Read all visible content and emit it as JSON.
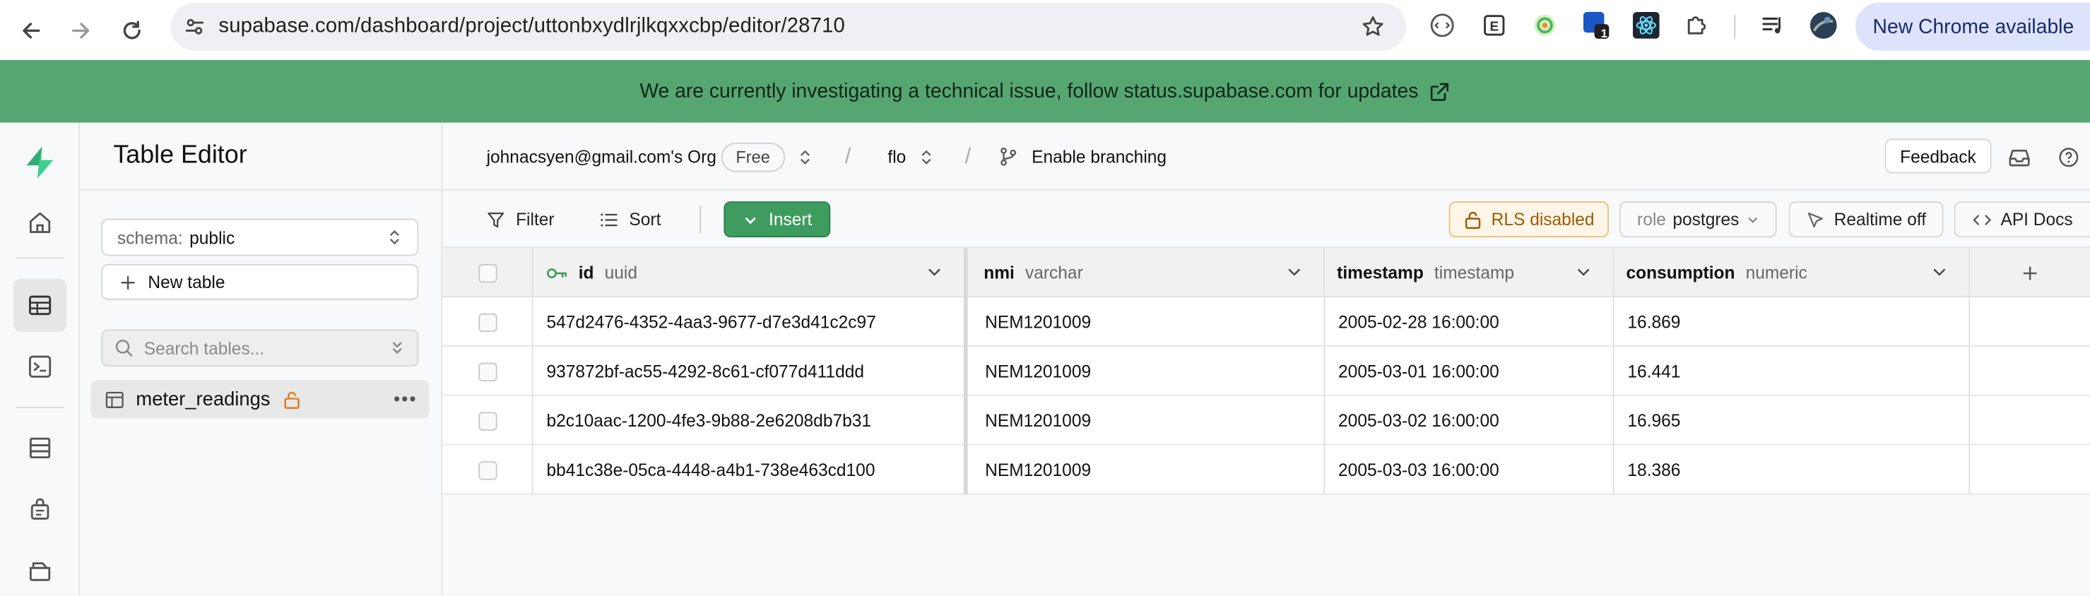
{
  "browser": {
    "url": "supabase.com/dashboard/project/uttonbxydlrjlkqxxcbp/editor/28710",
    "update_label": "New Chrome available",
    "badge_count": "1"
  },
  "banner": {
    "text": "We are currently investigating a technical issue, follow status.supabase.com for updates"
  },
  "sidebar": {
    "title": "Table Editor",
    "schema_label": "schema:",
    "schema_value": "public",
    "new_table_label": "New table",
    "search_placeholder": "Search tables...",
    "tables": [
      {
        "name": "meter_readings"
      }
    ]
  },
  "topbar": {
    "org": "johnacsyen@gmail.com's Org",
    "plan": "Free",
    "project": "flo",
    "branching": "Enable branching",
    "feedback": "Feedback"
  },
  "toolbar": {
    "filter": "Filter",
    "sort": "Sort",
    "insert": "Insert",
    "rls": "RLS disabled",
    "role_label": "role",
    "role_value": "postgres",
    "realtime": "Realtime off",
    "api_docs": "API Docs"
  },
  "grid": {
    "columns": [
      {
        "name": "id",
        "type": "uuid"
      },
      {
        "name": "nmi",
        "type": "varchar"
      },
      {
        "name": "timestamp",
        "type": "timestamp"
      },
      {
        "name": "consumption",
        "type": "numeric"
      }
    ],
    "rows": [
      [
        "547d2476-4352-4aa3-9677-d7e3d41c2c97",
        "NEM1201009",
        "2005-02-28 16:00:00",
        "16.869"
      ],
      [
        "937872bf-ac55-4292-8c61-cf077d411ddd",
        "NEM1201009",
        "2005-03-01 16:00:00",
        "16.441"
      ],
      [
        "b2c10aac-1200-4fe3-9b88-2e6208db7b31",
        "NEM1201009",
        "2005-03-02 16:00:00",
        "16.965"
      ],
      [
        "bb41c38e-05ca-4448-a4b1-738e463cd100",
        "NEM1201009",
        "2005-03-03 16:00:00",
        "18.386"
      ]
    ]
  },
  "colors": {
    "banner": "#56a672",
    "brand": "#3ecf8e",
    "insert": "#3e9c5f",
    "rls_warning": "#a05a00"
  }
}
